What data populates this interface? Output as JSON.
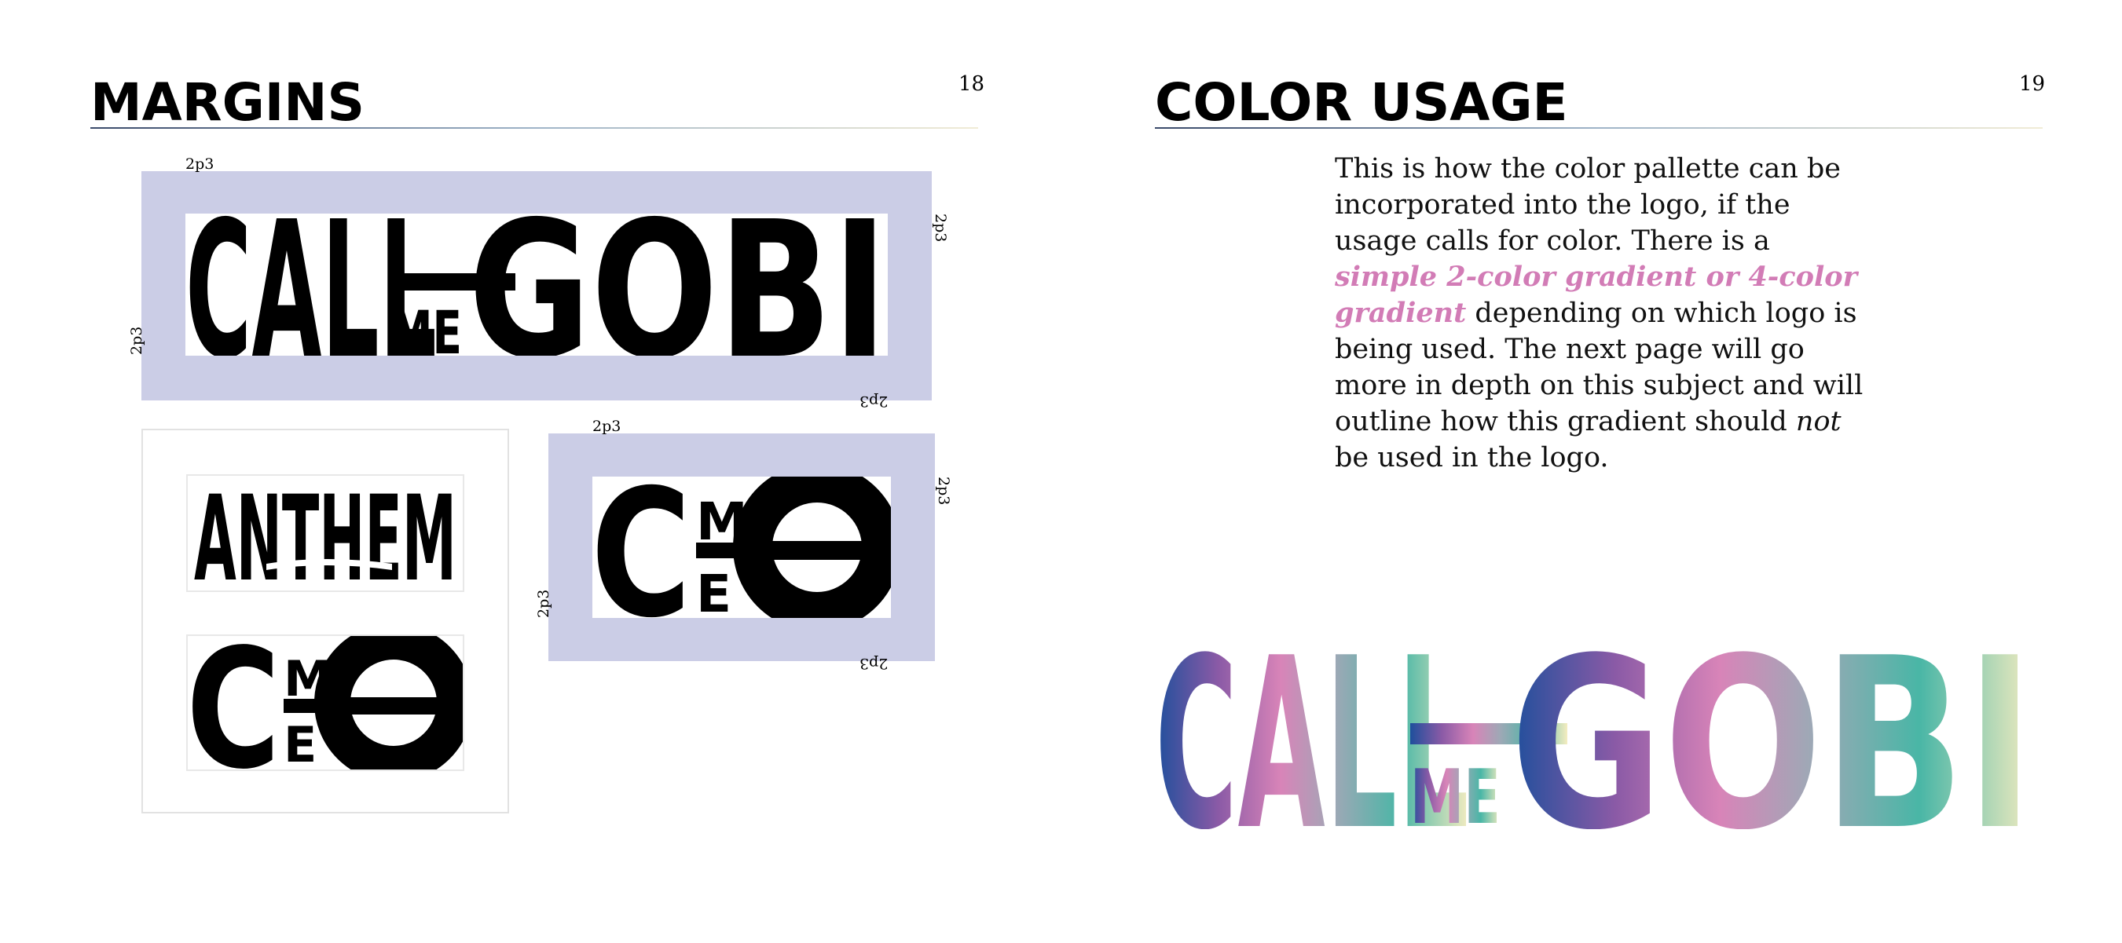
{
  "left_page": {
    "heading": "MARGINS",
    "page_number": "18",
    "margin_label": "2p3",
    "logos": {
      "wordmark_call": "CALL",
      "wordmark_me": "ME",
      "wordmark_gobi": "GOBI",
      "monogram_c": "C",
      "monogram_m": "M",
      "monogram_e": "E",
      "anthem": "ANTHEM"
    }
  },
  "right_page": {
    "heading": "COLOR USAGE",
    "page_number": "19",
    "body_before": "This is how the color pallette can be incorporated into the logo, if the usage calls for color. There is a ",
    "body_highlight": "simple 2-color gradient or 4-color gradient",
    "body_middle": " depending on which logo is being used. The next page will go more in depth on this subject and will outline how this gradient should ",
    "body_emphasis": "not",
    "body_after": " be used in the logo."
  },
  "colors": {
    "margin_fill": "#cbcde6",
    "highlight": "#d27cb6",
    "gradient": [
      "#1e4f9c",
      "#8a5aa6",
      "#d884b8",
      "#9fa8b6",
      "#49b6a6",
      "#f4ecc0"
    ]
  }
}
